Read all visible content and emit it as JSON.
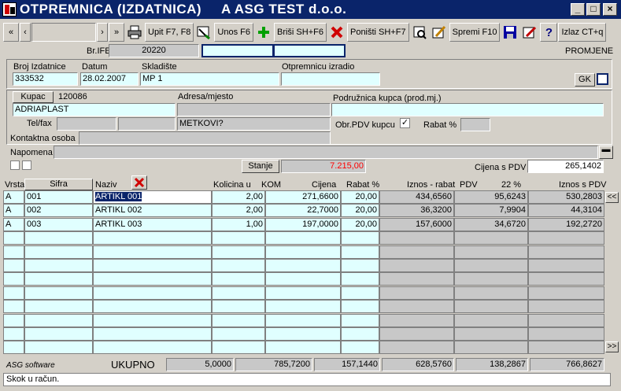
{
  "window": {
    "title": "OTPREMNICA (IZDATNICA)",
    "company": "A ASG TEST d.o.o."
  },
  "toolbar": {
    "nav_first": "«",
    "nav_prev": "‹",
    "nav_next": "›",
    "nav_last": "»",
    "upit": "Upit F7, F8",
    "unos": "Unos F6",
    "brisi": "Briši SH+F6",
    "ponisti": "Poništi SH+F7",
    "spremi": "Spremi F10",
    "izlaz": "Izlaz CT+q",
    "help": "?"
  },
  "header": {
    "br_ife_label": "Br.IFE",
    "br_ife_value": "20220",
    "promjene": "PROMJENE",
    "broj_izdatnice_label": "Broj Izdatnice",
    "broj_izdatnice": "333532",
    "datum_label": "Datum",
    "datum": "28.02.2007",
    "skladiste_label": "Skladište",
    "skladiste": "MP 1",
    "otpremnicu_izradio_label": "Otpremnicu izradio",
    "otpremnicu_izradio": "",
    "gk": "GK"
  },
  "customer": {
    "kupac_label": "Kupac",
    "kupac_id": "120086",
    "kupac_name": "ADRIAPLAST",
    "adresa_label": "Adresa/mjesto",
    "adresa": "",
    "mjesto": "METKOVI?",
    "podruznica_label": "Podružnica kupca (prod.mj.)",
    "telfax_label": "Tel/fax",
    "obr_pdv_label": "Obr.PDV kupcu",
    "rabat_label": "Rabat %",
    "rabat": "",
    "kontaktna_label": "Kontaktna osoba",
    "napomena_label": "Napomena",
    "stanje_label": "Stanje",
    "stanje": "7.215,00",
    "cijena_pdv_label": "Cijena s PDV",
    "cijena_pdv": "265,1402"
  },
  "table": {
    "headers": {
      "vrsta": "Vrsta",
      "sifra": "Sifra",
      "naziv": "Naziv",
      "kolicina": "Kolicina u",
      "kom": "KOM",
      "cijena": "Cijena",
      "rabat": "Rabat %",
      "iznos_rabat": "Iznos - rabat",
      "pdv": "PDV",
      "pdv_rate": "22 %",
      "iznos_pdv": "Iznos s PDV"
    },
    "rows": [
      {
        "vrsta": "A",
        "sifra": "001",
        "naziv": "ARTIKL 001",
        "kolicina": "2,00",
        "cijena": "271,6600",
        "rabat": "20,00",
        "iznos_rabat": "434,6560",
        "pdv": "95,6243",
        "iznos_pdv": "530,2803"
      },
      {
        "vrsta": "A",
        "sifra": "002",
        "naziv": "ARTIKL 002",
        "kolicina": "2,00",
        "cijena": "22,7000",
        "rabat": "20,00",
        "iznos_rabat": "36,3200",
        "pdv": "7,9904",
        "iznos_pdv": "44,3104"
      },
      {
        "vrsta": "A",
        "sifra": "003",
        "naziv": "ARTIKL 003",
        "kolicina": "1,00",
        "cijena": "197,0000",
        "rabat": "20,00",
        "iznos_rabat": "157,6000",
        "pdv": "34,6720",
        "iznos_pdv": "192,2720"
      }
    ],
    "scroll_up": "<<",
    "scroll_down": ">>"
  },
  "footer": {
    "brand": "ASG software",
    "ukupno_label": "UKUPNO",
    "kolicina": "5,0000",
    "cijena": "785,7200",
    "rabat": "157,1440",
    "iznos_rabat": "628,5760",
    "pdv": "138,2867",
    "iznos_pdv": "766,8627"
  },
  "status": "Skok u račun.",
  "colors": {
    "title_bar": "#0a246a",
    "field_cyan": "#e0ffff",
    "stanje_red": "#ff0000"
  }
}
